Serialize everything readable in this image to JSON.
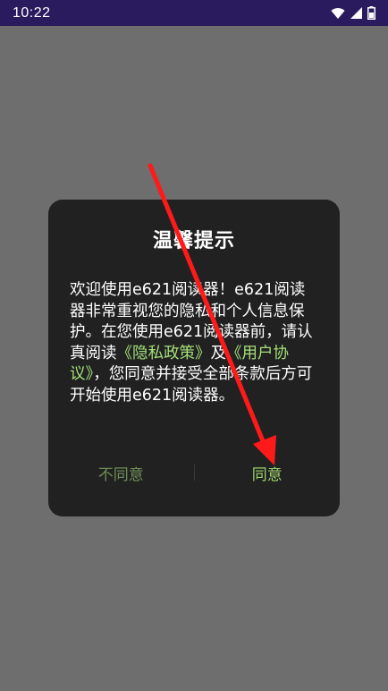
{
  "status_bar": {
    "time": "10:22",
    "icons": [
      "wifi-icon",
      "signal-icon",
      "battery-icon"
    ]
  },
  "dialog": {
    "title": "温馨提示",
    "body": {
      "intro": "欢迎使用e621阅读器！e621阅读器非常重视您的隐私和个人信息保护。在您使用e621阅读器前，请认真阅读",
      "privacy_link": "《隐私政策》",
      "and": "及",
      "agreement_link": "《用户协议》",
      "outro": "，您同意并接受全部条款后方可开始使用e621阅读器。"
    },
    "actions": {
      "disagree": "不同意",
      "agree": "同意"
    }
  },
  "colors": {
    "status_bar": "#2a1a5e",
    "dialog_bg": "#212121",
    "link": "#a4e07a",
    "agree": "#9bd36c",
    "disagree": "#6f8f57",
    "annotation_arrow": "#ff1a1a"
  }
}
